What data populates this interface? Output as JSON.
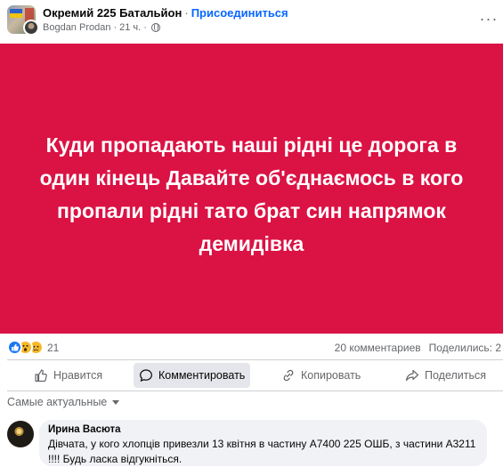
{
  "post": {
    "group_name": "Окремий 225 Батальйон",
    "separator": "·",
    "join_label": "Присоединиться",
    "author": "Bogdan Prodan",
    "time": "21 ч.",
    "time_dot": "·",
    "privacy_icon": "globe-icon",
    "more_icon": "more-icon",
    "more_label": "···",
    "background_color": "#db1244",
    "text": "Куди пропадають наші рідні це дорога в один кінець Давайте об'єднаємось в кого пропали рідні тато брат син напрямок демидівка"
  },
  "stats": {
    "reactions": [
      "like",
      "wow",
      "sad"
    ],
    "reaction_count": "21",
    "comments": "20 комментариев",
    "shares": "Поделились: 2"
  },
  "actions": {
    "like": "Нравится",
    "comment": "Комментировать",
    "copy": "Копировать",
    "share": "Поделиться"
  },
  "comments": {
    "sort_label": "Самые актуальные",
    "items": [
      {
        "author": "Ирина Васюта",
        "text": "Дівчата, у кого хлопців привезли 13 квітня в частину А7400 225 ОШБ, з частини А3211 !!!! Будь ласка відгукніться."
      }
    ]
  },
  "colors": {
    "accent": "#0866ff",
    "banner": "#db1244",
    "muted_text": "#65676b",
    "bubble": "#f0f2f5"
  }
}
